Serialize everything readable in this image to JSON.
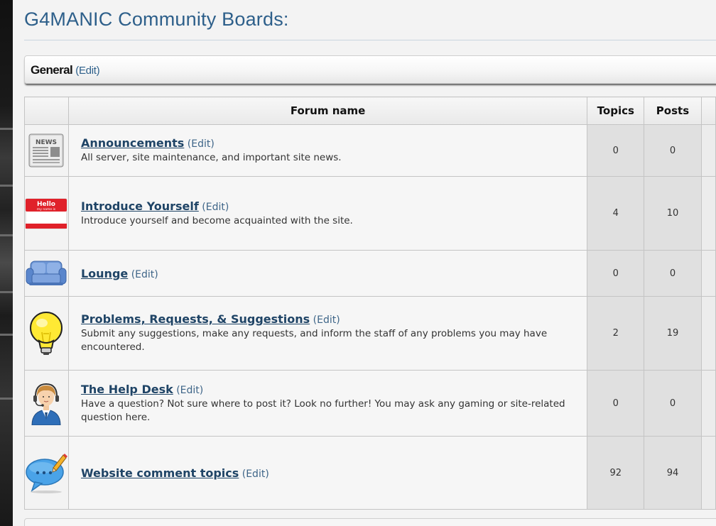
{
  "page": {
    "title": "G4MANIC Community Boards:"
  },
  "category": {
    "name": "General",
    "edit_label": "(Edit)"
  },
  "table": {
    "headers": {
      "forum_name": "Forum name",
      "topics": "Topics",
      "posts": "Posts"
    },
    "forums": [
      {
        "name": "Announcements",
        "edit": "(Edit)",
        "description": "All server, site maintenance, and important site news.",
        "topics": "0",
        "posts": "0",
        "icon": "newspaper-icon"
      },
      {
        "name": "Introduce Yourself",
        "edit": "(Edit)",
        "description": "Introduce yourself and become acquainted with the site.",
        "topics": "4",
        "posts": "10",
        "icon": "hello-name-tag-icon"
      },
      {
        "name": "Lounge",
        "edit": "(Edit)",
        "description": "",
        "topics": "0",
        "posts": "0",
        "icon": "sofa-icon"
      },
      {
        "name": "Problems, Requests, & Suggestions",
        "edit": "(Edit)",
        "description": "Submit any suggestions, make any requests, and inform the staff of any problems you may have encountered.",
        "topics": "2",
        "posts": "19",
        "icon": "lightbulb-icon"
      },
      {
        "name": "The Help Desk",
        "edit": "(Edit)",
        "description": "Have a question? Not sure where to post it? Look no further! You may ask any gaming or site-related question here.",
        "topics": "0",
        "posts": "0",
        "icon": "support-agent-icon"
      },
      {
        "name": "Website comment topics",
        "edit": "(Edit)",
        "description": "",
        "topics": "92",
        "posts": "94",
        "icon": "speech-bubble-pencil-icon"
      }
    ]
  },
  "icon_text": {
    "news": "NEWS",
    "hello": "Hello",
    "my_name_is": "my name is"
  },
  "colors": {
    "accent": "#2d5f8a",
    "link": "#1f4466"
  }
}
